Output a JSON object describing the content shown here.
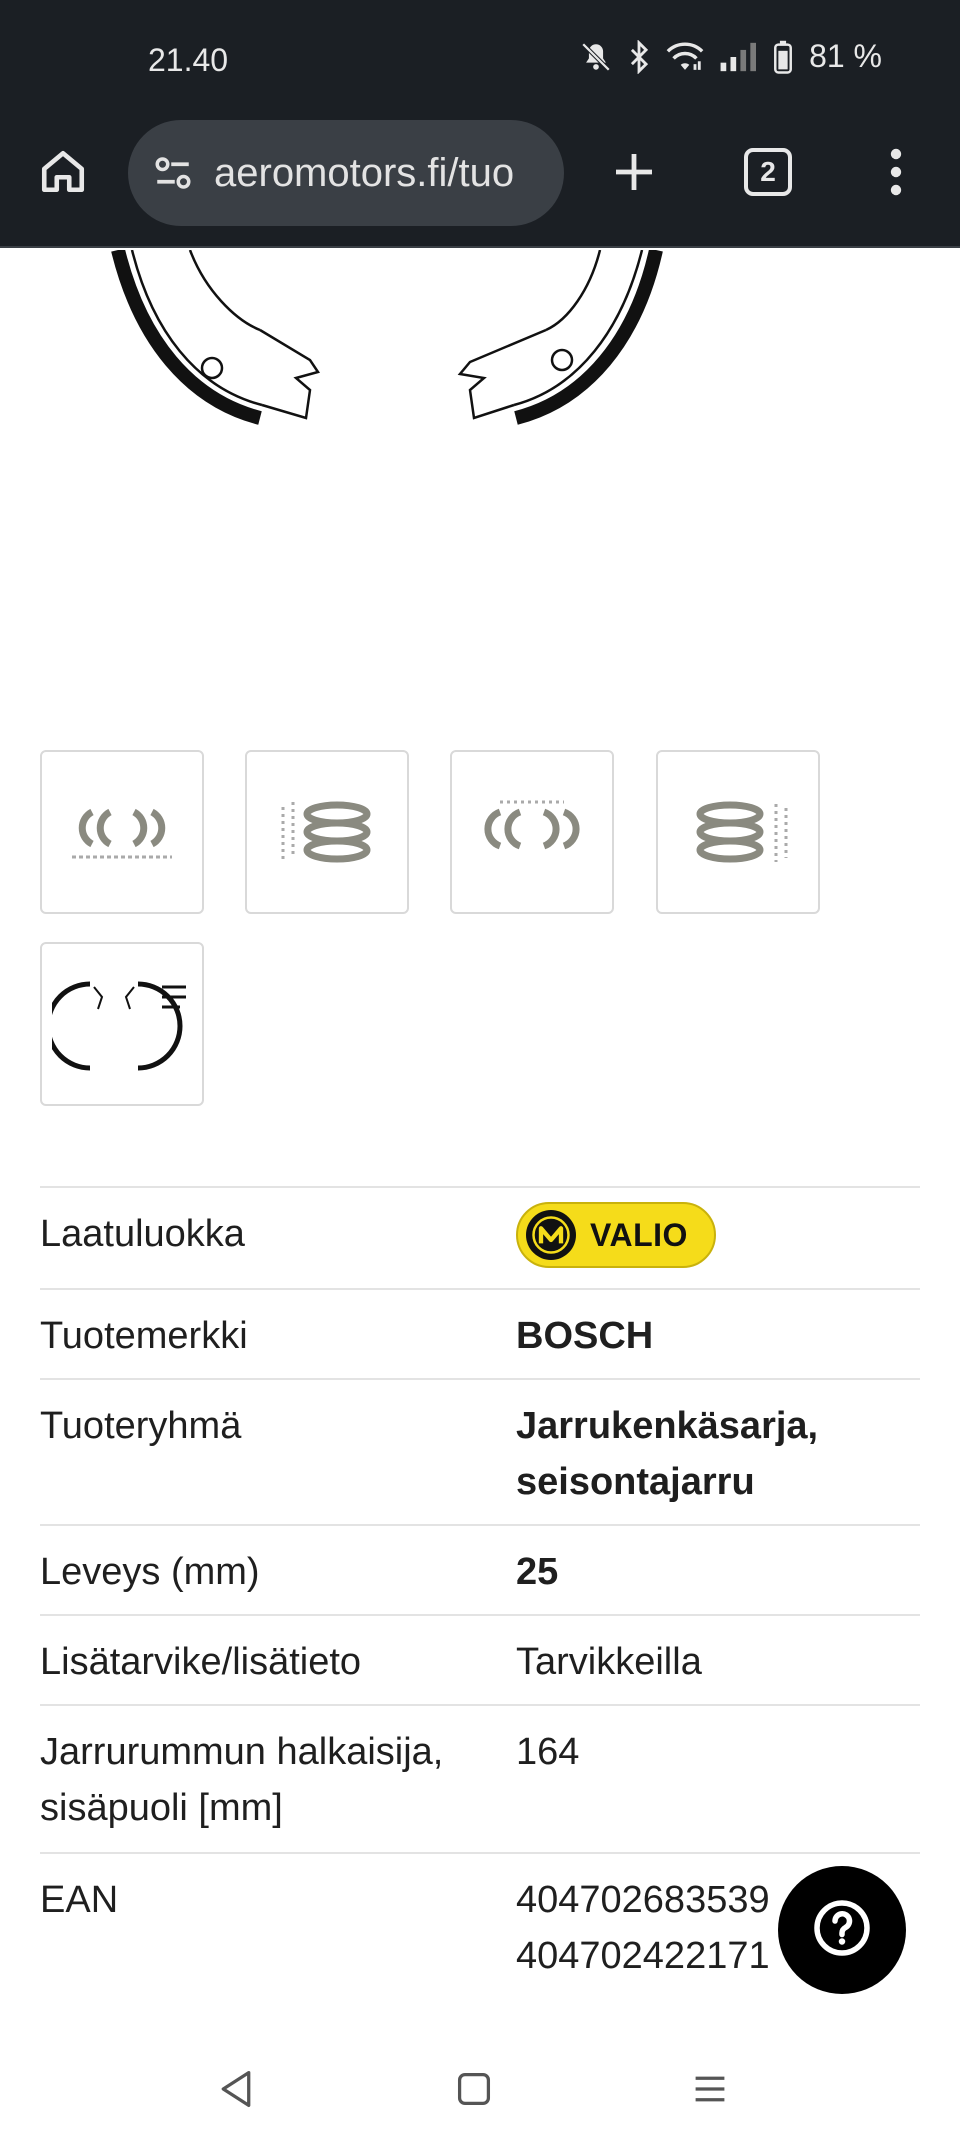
{
  "status_bar": {
    "time": "21.40",
    "battery": "81 %",
    "icons": [
      "mute-icon",
      "bluetooth-icon",
      "wifi-icon",
      "signal-icon",
      "battery-icon"
    ]
  },
  "browser": {
    "url": "aeromotors.fi/tuo",
    "tab_count": "2",
    "icons": [
      "home-icon",
      "site-settings-icon",
      "plus-icon",
      "tabs-icon",
      "more-vert-icon"
    ]
  },
  "thumbnails": [
    {
      "name": "thumbnail-1",
      "alt": "brake shoes set with accessories"
    },
    {
      "name": "thumbnail-2",
      "alt": "stacked brake shoes"
    },
    {
      "name": "thumbnail-3",
      "alt": "brake shoes pairs"
    },
    {
      "name": "thumbnail-4",
      "alt": "stacked brake shoes with parts"
    },
    {
      "name": "thumbnail-5",
      "alt": "brake shoes drawing"
    }
  ],
  "specs": {
    "quality_label": "Laatuluokka",
    "quality_badge": "VALIO",
    "brand_label": "Tuotemerkki",
    "brand_value": "BOSCH",
    "group_label": "Tuoteryhmä",
    "group_value_line1": "Jarrukenkäsarja,",
    "group_value_line2": "seisontajarru",
    "width_label": "Leveys (mm)",
    "width_value": "25",
    "accessory_label": "Lisätarvike/lisätieto",
    "accessory_value": "Tarvikkeilla",
    "drum_label_line1": "Jarrurummun halkaisija,",
    "drum_label_line2": "sisäpuoli [mm]",
    "drum_value": "164",
    "ean_label": "EAN",
    "ean_value_line1": "404702683539",
    "ean_value_line2": "404702422171"
  },
  "colors": {
    "browser_bg": "#1b1f24",
    "url_pill": "#3a3f45",
    "badge_yellow": "#f5dc1a",
    "divider": "#e3e3e3"
  },
  "nav": {
    "icons": [
      "back-icon",
      "home-nav-icon",
      "recents-icon"
    ]
  }
}
